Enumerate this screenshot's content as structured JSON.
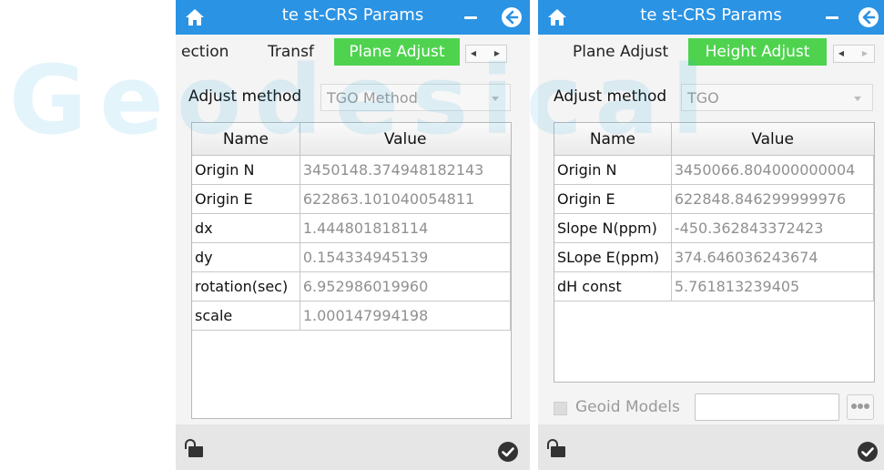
{
  "watermark": "Geodesical",
  "icons": {
    "home": "home-icon",
    "minimize": "minimize-icon",
    "back": "back-arrow-icon",
    "lock": "unlock-icon",
    "confirm": "checkmark-circle-icon"
  },
  "colors": {
    "titlebar": "#2a93e4",
    "active_tab": "#4fd34f",
    "watermark": "#29abe2"
  },
  "left": {
    "title": "te st-CRS Params",
    "tabs": [
      "ection",
      "Transf",
      "Plane Adjust"
    ],
    "active_tab": "Plane Adjust",
    "tab_arrows": [
      "◀",
      "▶"
    ],
    "method_label": "Adjust method",
    "method_value": "TGO Method",
    "columns": [
      "Name",
      "Value"
    ],
    "rows": [
      {
        "name": "Origin N",
        "value": "3450148.374948182143"
      },
      {
        "name": "Origin E",
        "value": "622863.101040054811"
      },
      {
        "name": "dx",
        "value": "1.444801818114"
      },
      {
        "name": "dy",
        "value": "0.154334945139"
      },
      {
        "name": "rotation(sec)",
        "value": "6.952986019960"
      },
      {
        "name": "scale",
        "value": "1.000147994198"
      }
    ]
  },
  "right": {
    "title": "te st-CRS Params",
    "tabs": [
      "Plane Adjust",
      "Height Adjust"
    ],
    "active_tab": "Height Adjust",
    "tab_arrows": [
      "◀",
      "▶"
    ],
    "method_label": "Adjust method",
    "method_value": "TGO",
    "columns": [
      "Name",
      "Value"
    ],
    "rows": [
      {
        "name": "Origin N",
        "value": "3450066.804000000004"
      },
      {
        "name": "Origin E",
        "value": "622848.846299999976"
      },
      {
        "name": "Slope N(ppm)",
        "value": "-450.362843372423"
      },
      {
        "name": "SLope E(ppm)",
        "value": "374.646036243674"
      },
      {
        "name": "dH const",
        "value": "5.761813239405"
      }
    ],
    "geoid": {
      "label": "Geoid Models",
      "checked": false,
      "value": ""
    }
  }
}
